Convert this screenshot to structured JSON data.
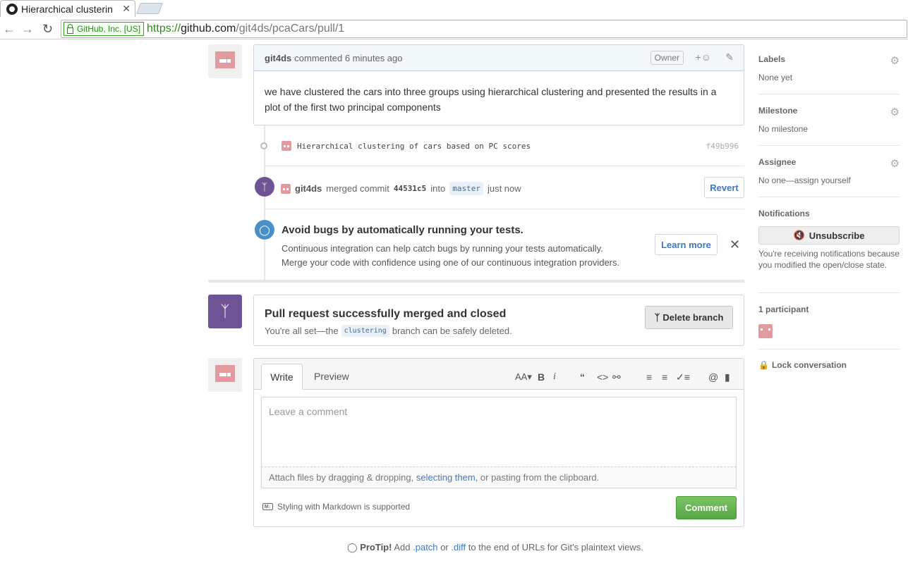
{
  "browser": {
    "tab_title": "Hierarchical clusterin",
    "tab_close": "✕",
    "ev_label": "GitHub, Inc. [US]",
    "url_scheme": "https://",
    "url_host": "github.com",
    "url_path": "/git4ds/pcaCars/pull/1"
  },
  "comment": {
    "author": "git4ds",
    "action": "commented 6 minutes ago",
    "badge": "Owner",
    "body": "we have clustered the cars into three groups using hierarchical clustering and presented the results in a plot of the first two principal components"
  },
  "commit": {
    "message": "Hierarchical clustering of cars based on PC scores",
    "sha": "f49b996"
  },
  "merge_event": {
    "author": "git4ds",
    "action": "merged commit",
    "sha": "44531c5",
    "into": "into",
    "branch": "master",
    "time": "just now",
    "revert_label": "Revert"
  },
  "ci": {
    "title": "Avoid bugs by automatically running your tests.",
    "line1": "Continuous integration can help catch bugs by running your tests automatically.",
    "line2": "Merge your code with confidence using one of our continuous integration providers.",
    "learn_more": "Learn more"
  },
  "merged": {
    "title": "Pull request successfully merged and closed",
    "sub_prefix": "You're all set—the",
    "branch": "clustering",
    "sub_suffix": "branch can be safely deleted.",
    "delete_label": "Delete branch"
  },
  "editor": {
    "tab_write": "Write",
    "tab_preview": "Preview",
    "placeholder": "Leave a comment",
    "attach_prefix": "Attach files by dragging & dropping, ",
    "attach_link": "selecting them",
    "attach_suffix": ", or pasting from the clipboard.",
    "markdown_note": "Styling with Markdown is supported",
    "comment_label": "Comment"
  },
  "protip": {
    "label": "ProTip!",
    "text1": "Add",
    "patch": ".patch",
    "or": "or",
    "diff": ".diff",
    "text2": "to the end of URLs for Git's plaintext views."
  },
  "sidebar": {
    "labels_h": "Labels",
    "labels_v": "None yet",
    "milestone_h": "Milestone",
    "milestone_v": "No milestone",
    "assignee_h": "Assignee",
    "assignee_v": "No one—assign yourself",
    "notifications_h": "Notifications",
    "unsubscribe": "Unsubscribe",
    "notif_text": "You're receiving notifications because you modified the open/close state.",
    "participants": "1 participant",
    "lock": "Lock conversation"
  }
}
